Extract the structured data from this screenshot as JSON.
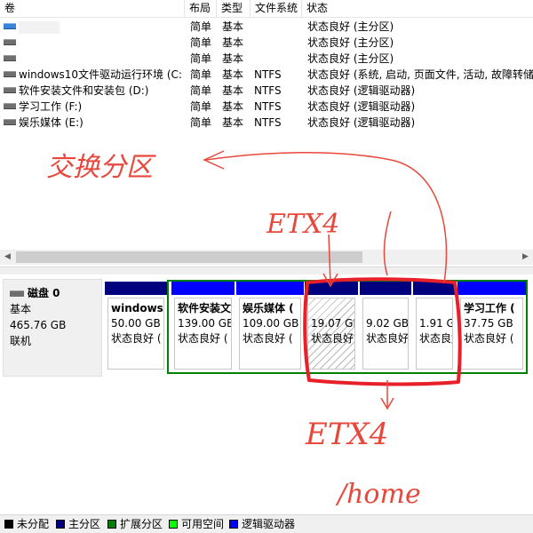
{
  "columns": {
    "volume": "卷",
    "layout": "布局",
    "type": "类型",
    "fs": "文件系统",
    "status": "状态"
  },
  "volumes": [
    {
      "name": "",
      "layout": "简单",
      "type": "基本",
      "fs": "",
      "status": "状态良好 (主分区)",
      "icon": "drive-blue-icon"
    },
    {
      "name": "",
      "layout": "简单",
      "type": "基本",
      "fs": "",
      "status": "状态良好 (主分区)",
      "icon": "drive-icon"
    },
    {
      "name": "",
      "layout": "简单",
      "type": "基本",
      "fs": "",
      "status": "状态良好 (主分区)",
      "icon": "drive-icon"
    },
    {
      "name": "windows10文件驱动运行环境 (C:)",
      "layout": "简单",
      "type": "基本",
      "fs": "NTFS",
      "status": "状态良好 (系统, 启动, 页面文件, 活动, 故障转储",
      "icon": "drive-icon"
    },
    {
      "name": "软件安装文件和安装包 (D:)",
      "layout": "简单",
      "type": "基本",
      "fs": "NTFS",
      "status": "状态良好 (逻辑驱动器)",
      "icon": "drive-icon"
    },
    {
      "name": "学习工作 (F:)",
      "layout": "简单",
      "type": "基本",
      "fs": "NTFS",
      "status": "状态良好 (逻辑驱动器)",
      "icon": "drive-icon"
    },
    {
      "name": "娱乐媒体 (E:)",
      "layout": "简单",
      "type": "基本",
      "fs": "NTFS",
      "status": "状态良好 (逻辑驱动器)",
      "icon": "drive-icon"
    }
  ],
  "disk": {
    "name": "磁盘 0",
    "kind": "基本",
    "size": "465.76 GB",
    "state": "联机"
  },
  "partitions": [
    {
      "name": "windows",
      "size": "50.00 GB",
      "status": "状态良好 (",
      "bar_color": "#00007f"
    },
    {
      "name": "软件安装文",
      "size": "139.00 GB",
      "status": "状态良好 (",
      "bar_color": "#0000ff"
    },
    {
      "name": "娱乐媒体 (",
      "size": "109.00 GB",
      "status": "状态良好 (",
      "bar_color": "#0000ff"
    },
    {
      "name": "",
      "size": "19.07 GB",
      "status": "状态良好",
      "bar_color": "#00007f",
      "hatched": true
    },
    {
      "name": "",
      "size": "9.02 GB",
      "status": "状态良好",
      "bar_color": "#00007f"
    },
    {
      "name": "",
      "size": "1.91 G",
      "status": "状态良好",
      "bar_color": "#00007f"
    },
    {
      "name": "学习工作 (",
      "size": "37.75 GB",
      "status": "状态良好 (",
      "bar_color": "#0000ff"
    }
  ],
  "legend": [
    {
      "label": "未分配",
      "color": "#000000"
    },
    {
      "label": "主分区",
      "color": "#00007f"
    },
    {
      "label": "扩展分区",
      "color": "#008000"
    },
    {
      "label": "可用空间",
      "color": "#00ff00"
    },
    {
      "label": "逻辑驱动器",
      "color": "#0000ff"
    }
  ],
  "annotations": {
    "swap": "交换分区",
    "ext4_top": "ETX4",
    "ext4_bottom": "ETX4",
    "home": "/home"
  },
  "colors": {
    "annotation": "#e8473c",
    "highlight": "#e8202a",
    "extended_frame": "#008000"
  }
}
